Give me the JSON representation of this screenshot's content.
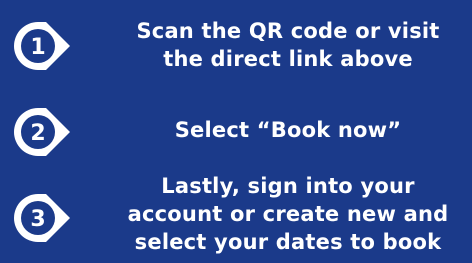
{
  "colors": {
    "background": "#1b3a8a",
    "text": "#ffffff",
    "badge_ring": "#ffffff",
    "badge_fill": "#1b3a8a"
  },
  "steps": [
    {
      "number": "1",
      "icon": "numbered-circle-arrow-icon",
      "lines": [
        "Scan the QR code or visit",
        "the direct link above"
      ]
    },
    {
      "number": "2",
      "icon": "numbered-circle-arrow-icon",
      "lines": [
        "Select “Book now”"
      ]
    },
    {
      "number": "3",
      "icon": "numbered-circle-arrow-icon",
      "lines": [
        "Lastly, sign into your",
        "account or create new and",
        "select your dates to book"
      ]
    }
  ]
}
